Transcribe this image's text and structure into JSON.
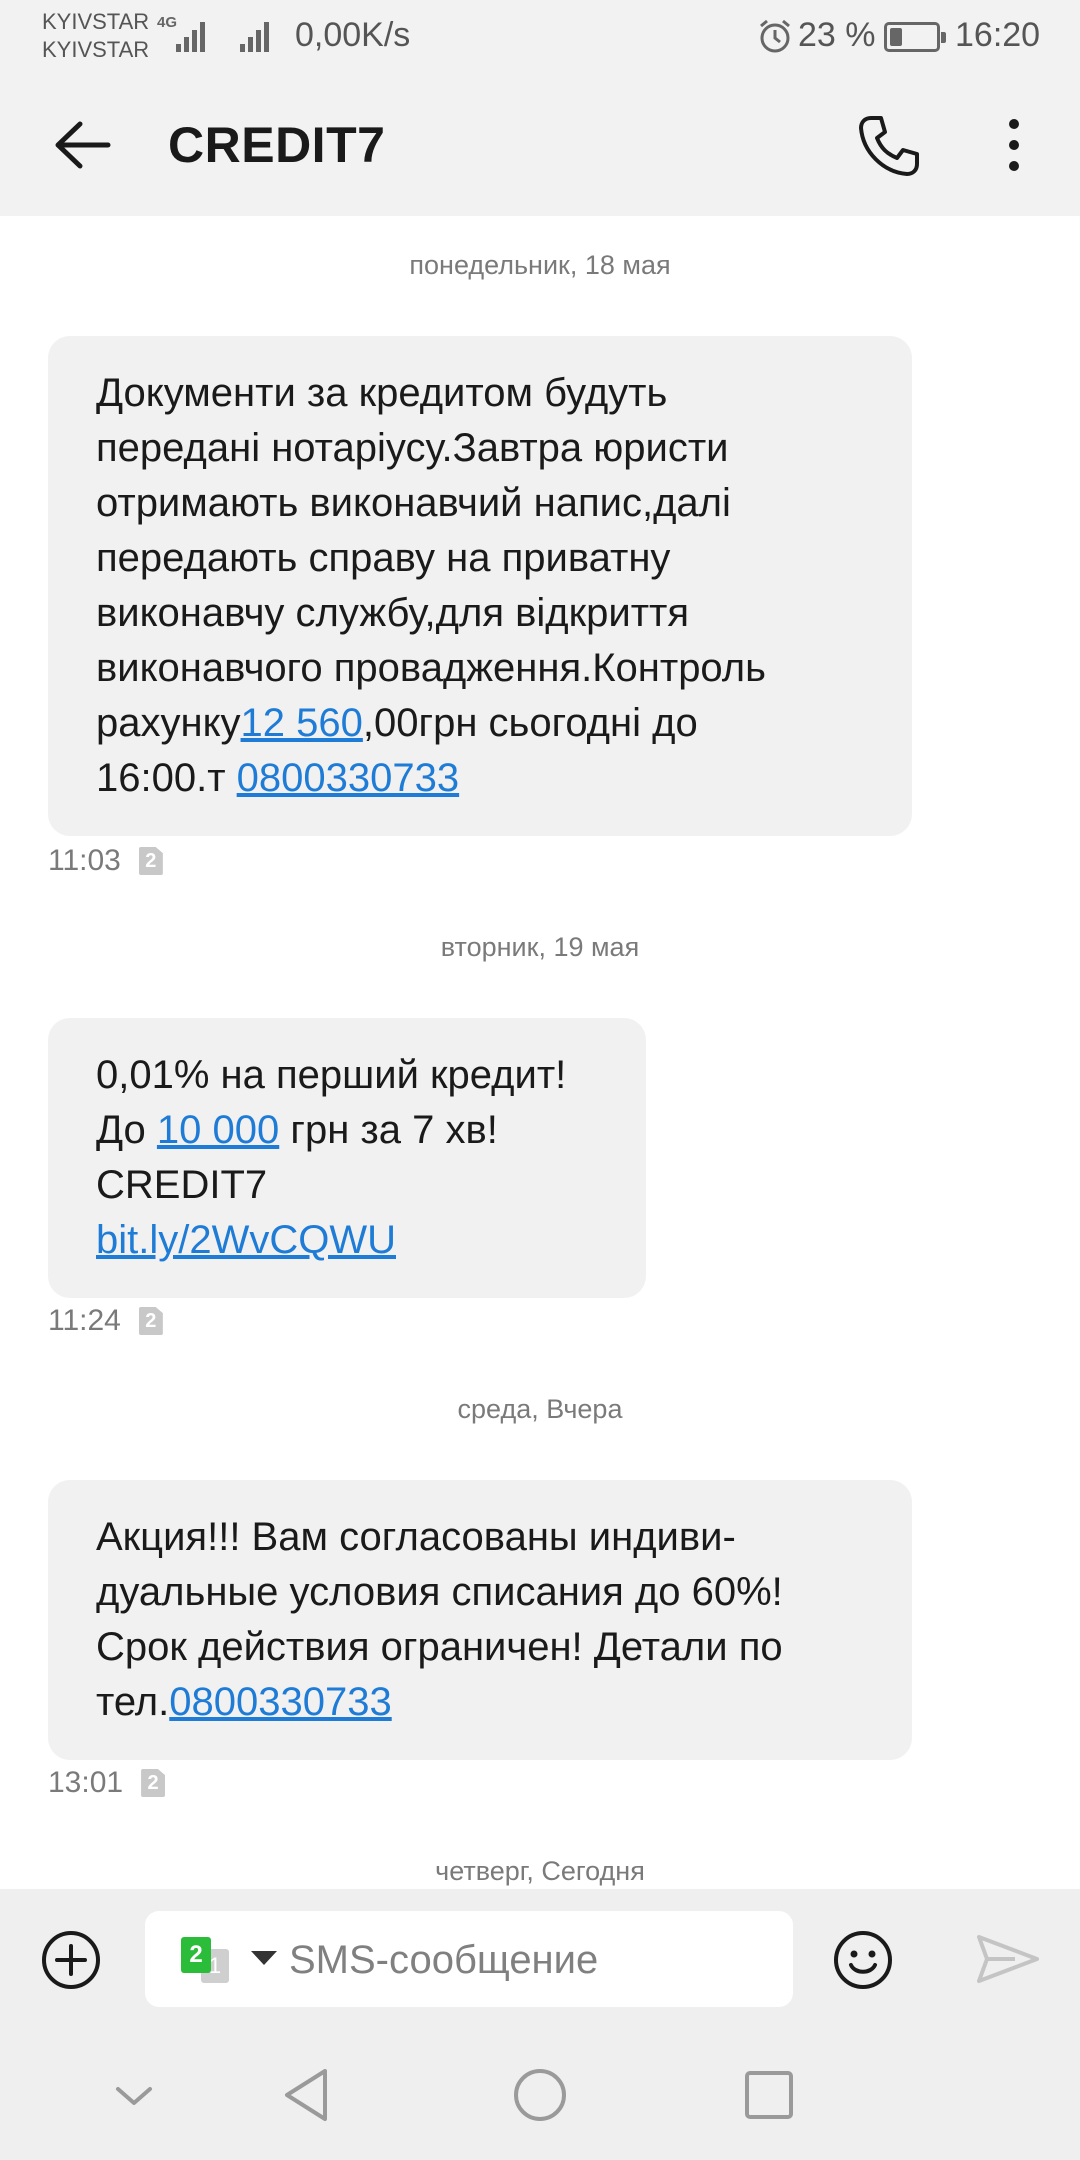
{
  "status_bar": {
    "carrier_1": "KYIVSTAR",
    "carrier_2": "KYIVSTAR",
    "network_type": "4G",
    "net_speed": "0,00K/s",
    "battery_percent": "23 %",
    "battery_level": 0.23,
    "time": "16:20"
  },
  "header": {
    "title": "CREDIT7",
    "back_icon": "arrow-left-icon",
    "call_icon": "phone-icon",
    "more_icon": "more-vert-icon"
  },
  "messages": [
    {
      "date": "понедельник, 18 мая",
      "parts": [
        "Документи за кредитом будуть",
        "передані нотаріусу.Завтра юристи",
        "отримають виконавчий напис,далі",
        "передають справу на приватну",
        "виконавчу службу,для відкриття",
        "виконавчого провадження.Контроль",
        "рахунку",
        "12 560",
        ",00грн сьогодні до",
        "16:00.т ",
        "0800330733"
      ],
      "time": "11:03",
      "sim": "2"
    },
    {
      "date": "вторник, 19 мая",
      "parts": [
        "0,01% на перший кредит!",
        "До ",
        "10 000",
        " грн за 7 хв!",
        "CREDIT7",
        "bit.ly/2WvCQWU"
      ],
      "time": "11:24",
      "sim": "2"
    },
    {
      "date": "среда, Вчера",
      "parts": [
        "Акция!!! Вам согласованы индиви-",
        "дуальные условия списания до 60%!",
        "Срок действия ограничен! Детали по",
        "тел.",
        "0800330733"
      ],
      "time": "13:01",
      "sim": "2"
    }
  ],
  "next_date": "четверг, Сегодня",
  "composer": {
    "placeholder": "SMS-сообщение",
    "sim_primary": "2",
    "sim_secondary": "1",
    "add_icon": "plus-circle-icon",
    "emoji_icon": "smiley-icon",
    "send_icon": "send-icon"
  },
  "navigation": {
    "hide_icon": "chevron-down-icon",
    "back_icon": "triangle-back-icon",
    "home_icon": "circle-home-icon",
    "recents_icon": "square-recents-icon"
  },
  "colors": {
    "link": "#1f7cd6",
    "bubble": "#f1f1f1",
    "sim_active": "#2bbd3a"
  }
}
